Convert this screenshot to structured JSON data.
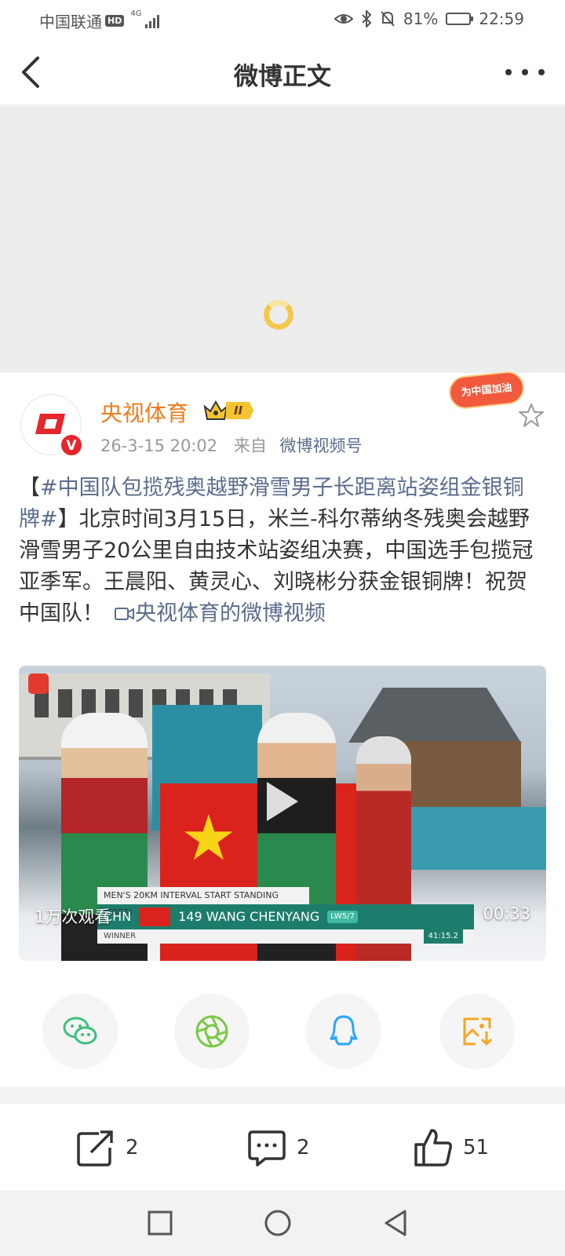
{
  "status_bar": {
    "carrier": "中国联通",
    "hd": "HD",
    "network": "4G",
    "battery": "81%",
    "battery_level": 0.81,
    "time": "22:59"
  },
  "nav": {
    "title": "微博正文",
    "back_icon": "chevron-left-icon",
    "more_icon": "more-dots-icon"
  },
  "post": {
    "author": "央视体育",
    "vip_level": "II",
    "verified_mark": "V",
    "timestamp": "26-3-15 20:02",
    "source_prefix": "来自",
    "source": "微博视频号",
    "cheer_badge": "为中国加油",
    "text_open_bracket": "【",
    "topic": "#中国队包揽残奥越野滑雪男子长距离站姿组金银铜牌#",
    "text_body": "】北京时间3月15日，米兰-科尔蒂纳冬残奥会越野滑雪男子20公里自由技术站姿组决赛，中国选手包揽冠亚季军。王晨阳、黄灵心、刘晓彬分获金银铜牌！祝贺中国队！",
    "video_link": "央视体育的微博视频"
  },
  "video": {
    "views": "1万次观看",
    "duration": "00:33",
    "caption_event": "MEN'S 20KM INTERVAL START STANDING (FREE)",
    "caption_country": "CHN",
    "caption_athlete": "149 WANG CHENYANG",
    "caption_class": "LW5/7",
    "caption_result": "WINNER",
    "caption_time": "41:15.2"
  },
  "share": [
    {
      "name": "wechat",
      "icon": "wechat-icon",
      "color": "#3cc07a"
    },
    {
      "name": "moments",
      "icon": "moments-icon",
      "color": "#7ac943"
    },
    {
      "name": "qq",
      "icon": "qq-icon",
      "color": "#2aa6f5"
    },
    {
      "name": "save-image",
      "icon": "save-image-icon",
      "color": "#f5a623"
    }
  ],
  "actions": {
    "repost_count": "2",
    "comment_count": "2",
    "like_count": "51"
  },
  "colors": {
    "author": "#ee7b1a",
    "link": "#5b6c8c",
    "verified": "#e5262d"
  }
}
